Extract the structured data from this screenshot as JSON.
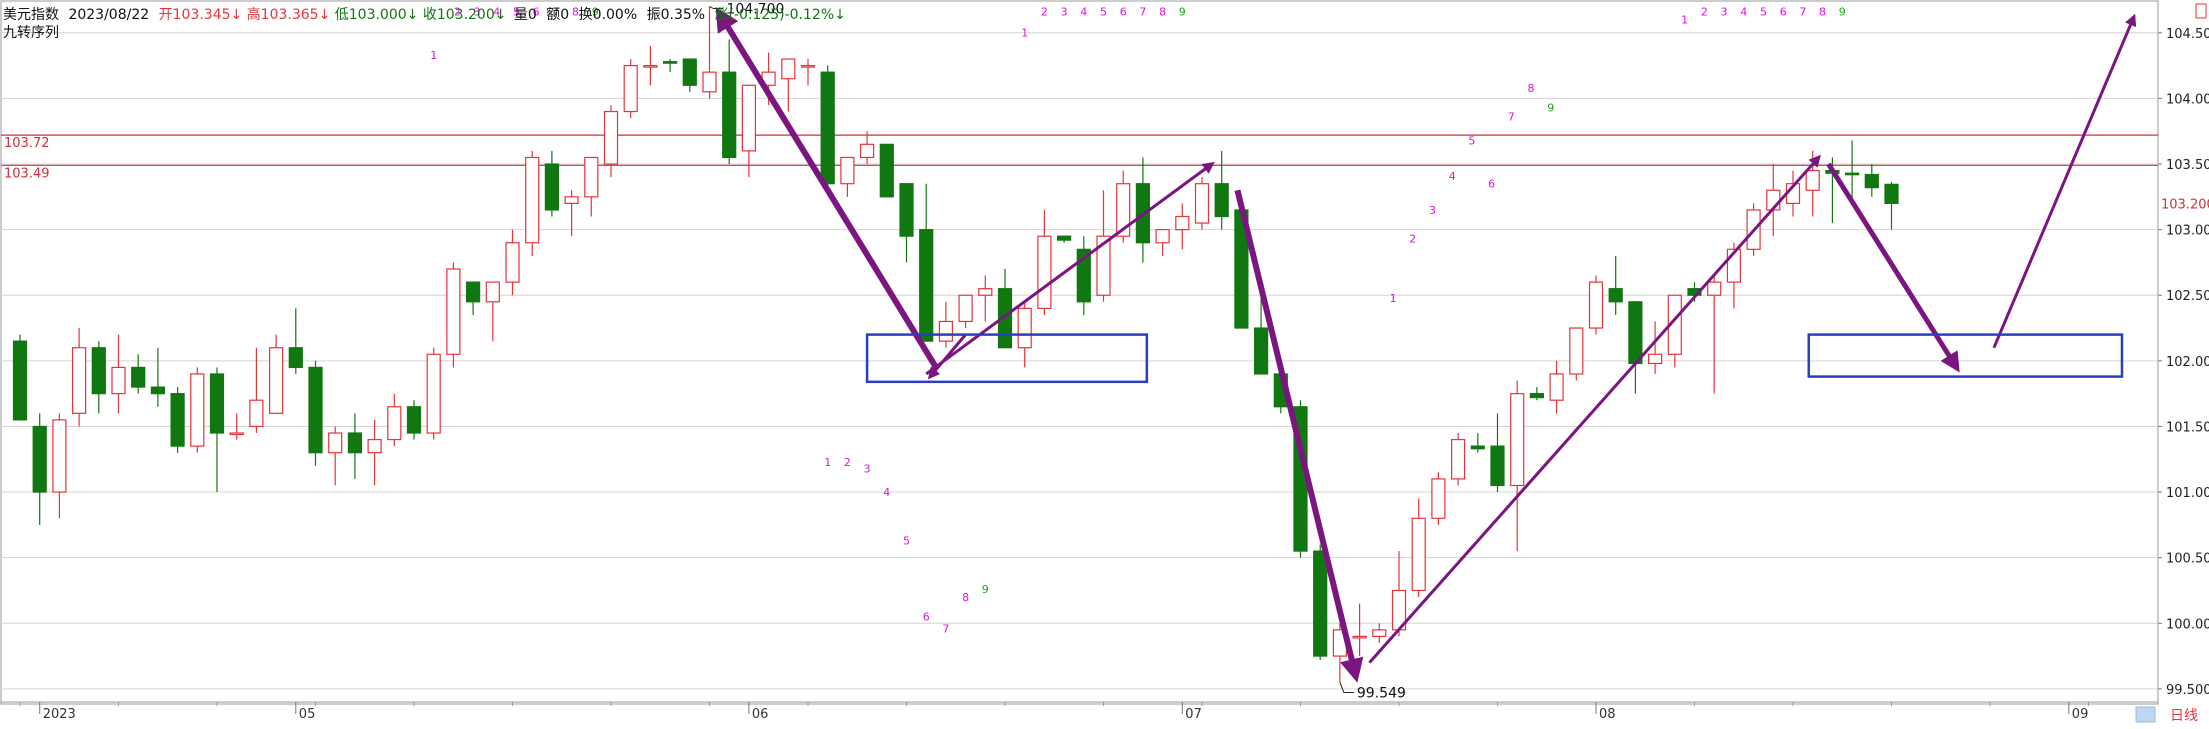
{
  "header": {
    "name": "美元指数",
    "date": "2023/08/22",
    "open": "开103.345↓",
    "high": "高103.365↓",
    "low": "低103.000↓",
    "close": "收103.200↓",
    "volume": "量0",
    "amount": "额0",
    "turnover": "换0.00%",
    "amplitude": "振0.35%",
    "change": "涨(-0.125)-0.12%↓"
  },
  "indicator_label": "九转序列",
  "footer_label": "日线",
  "colors": {
    "up": "#e8333a",
    "down": "#117711",
    "grid": "#d4d4d4",
    "arrow": "#7b1580",
    "box": "#2a3fbf",
    "seq_magenta": "#e010e0",
    "seq_green": "#1aa51a"
  },
  "chart_data": {
    "type": "candlestick",
    "ylim": [
      99.4,
      104.75
    ],
    "yticks": [
      "104.500",
      "104.000",
      "103.500",
      "103.000",
      "102.500",
      "102.000",
      "101.500",
      "101.000",
      "100.500",
      "100.000",
      "99.500"
    ],
    "ytick_values": [
      104.5,
      104.0,
      103.5,
      103.0,
      102.5,
      102.0,
      101.5,
      101.0,
      100.5,
      100.0,
      99.5
    ],
    "xlabels": [
      {
        "label": "2023",
        "index": 1
      },
      {
        "label": "05",
        "index": 14
      },
      {
        "label": "06",
        "index": 37
      },
      {
        "label": "07",
        "index": 59
      },
      {
        "label": "08",
        "index": 80
      },
      {
        "label": "09",
        "index": 104
      }
    ],
    "candles": [
      {
        "o": 102.15,
        "h": 102.2,
        "l": 101.55,
        "c": 101.55
      },
      {
        "o": 101.5,
        "h": 101.6,
        "l": 100.75,
        "c": 101.0
      },
      {
        "o": 101.0,
        "h": 101.6,
        "l": 100.8,
        "c": 101.55
      },
      {
        "o": 101.6,
        "h": 102.25,
        "l": 101.5,
        "c": 102.1
      },
      {
        "o": 102.1,
        "h": 102.15,
        "l": 101.6,
        "c": 101.75
      },
      {
        "o": 101.75,
        "h": 102.2,
        "l": 101.6,
        "c": 101.95
      },
      {
        "o": 101.95,
        "h": 102.05,
        "l": 101.75,
        "c": 101.8
      },
      {
        "o": 101.8,
        "h": 102.1,
        "l": 101.65,
        "c": 101.75
      },
      {
        "o": 101.75,
        "h": 101.8,
        "l": 101.3,
        "c": 101.35
      },
      {
        "o": 101.35,
        "h": 101.95,
        "l": 101.3,
        "c": 101.9
      },
      {
        "o": 101.9,
        "h": 101.95,
        "l": 101.0,
        "c": 101.45
      },
      {
        "o": 101.45,
        "h": 101.6,
        "l": 101.4,
        "c": 101.45
      },
      {
        "o": 101.5,
        "h": 102.1,
        "l": 101.45,
        "c": 101.7
      },
      {
        "o": 101.6,
        "h": 102.2,
        "l": 101.6,
        "c": 102.1
      },
      {
        "o": 102.1,
        "h": 102.4,
        "l": 101.9,
        "c": 101.95
      },
      {
        "o": 101.95,
        "h": 102.0,
        "l": 101.2,
        "c": 101.3
      },
      {
        "o": 101.3,
        "h": 101.5,
        "l": 101.05,
        "c": 101.45
      },
      {
        "o": 101.45,
        "h": 101.6,
        "l": 101.1,
        "c": 101.3
      },
      {
        "o": 101.3,
        "h": 101.55,
        "l": 101.05,
        "c": 101.4
      },
      {
        "o": 101.4,
        "h": 101.75,
        "l": 101.35,
        "c": 101.65
      },
      {
        "o": 101.65,
        "h": 101.7,
        "l": 101.4,
        "c": 101.45
      },
      {
        "o": 101.45,
        "h": 102.1,
        "l": 101.4,
        "c": 102.05
      },
      {
        "o": 102.05,
        "h": 102.75,
        "l": 101.95,
        "c": 102.7
      },
      {
        "o": 102.6,
        "h": 102.6,
        "l": 102.35,
        "c": 102.45
      },
      {
        "o": 102.45,
        "h": 102.6,
        "l": 102.15,
        "c": 102.6
      },
      {
        "o": 102.6,
        "h": 103.0,
        "l": 102.5,
        "c": 102.9
      },
      {
        "o": 102.9,
        "h": 103.6,
        "l": 102.8,
        "c": 103.55
      },
      {
        "o": 103.5,
        "h": 103.6,
        "l": 103.1,
        "c": 103.15
      },
      {
        "o": 103.2,
        "h": 103.3,
        "l": 102.95,
        "c": 103.25
      },
      {
        "o": 103.25,
        "h": 103.55,
        "l": 103.1,
        "c": 103.55
      },
      {
        "o": 103.5,
        "h": 103.95,
        "l": 103.4,
        "c": 103.9
      },
      {
        "o": 103.9,
        "h": 104.3,
        "l": 103.85,
        "c": 104.25
      },
      {
        "o": 104.25,
        "h": 104.4,
        "l": 104.1,
        "c": 104.25
      },
      {
        "o": 104.28,
        "h": 104.3,
        "l": 104.2,
        "c": 104.27
      },
      {
        "o": 104.3,
        "h": 104.3,
        "l": 104.05,
        "c": 104.1
      },
      {
        "o": 104.05,
        "h": 104.7,
        "l": 104.0,
        "c": 104.2
      },
      {
        "o": 104.2,
        "h": 104.45,
        "l": 103.5,
        "c": 103.55
      },
      {
        "o": 103.6,
        "h": 104.1,
        "l": 103.4,
        "c": 104.1
      },
      {
        "o": 104.1,
        "h": 104.35,
        "l": 103.95,
        "c": 104.2
      },
      {
        "o": 104.15,
        "h": 104.3,
        "l": 103.9,
        "c": 104.3
      },
      {
        "o": 104.25,
        "h": 104.3,
        "l": 104.1,
        "c": 104.25
      },
      {
        "o": 104.2,
        "h": 104.25,
        "l": 103.3,
        "c": 103.35
      },
      {
        "o": 103.35,
        "h": 103.55,
        "l": 103.25,
        "c": 103.55
      },
      {
        "o": 103.55,
        "h": 103.75,
        "l": 103.5,
        "c": 103.65
      },
      {
        "o": 103.65,
        "h": 103.65,
        "l": 103.25,
        "c": 103.25
      },
      {
        "o": 103.35,
        "h": 103.35,
        "l": 102.75,
        "c": 102.95
      },
      {
        "o": 103.0,
        "h": 103.35,
        "l": 102.15,
        "c": 102.15
      },
      {
        "o": 102.15,
        "h": 102.45,
        "l": 102.1,
        "c": 102.3
      },
      {
        "o": 102.3,
        "h": 102.5,
        "l": 102.25,
        "c": 102.5
      },
      {
        "o": 102.5,
        "h": 102.65,
        "l": 102.3,
        "c": 102.55
      },
      {
        "o": 102.55,
        "h": 102.7,
        "l": 102.1,
        "c": 102.1
      },
      {
        "o": 102.1,
        "h": 102.45,
        "l": 101.95,
        "c": 102.4
      },
      {
        "o": 102.4,
        "h": 103.15,
        "l": 102.35,
        "c": 102.95
      },
      {
        "o": 102.95,
        "h": 102.95,
        "l": 102.9,
        "c": 102.92
      },
      {
        "o": 102.85,
        "h": 102.95,
        "l": 102.35,
        "c": 102.45
      },
      {
        "o": 102.5,
        "h": 103.3,
        "l": 102.45,
        "c": 102.95
      },
      {
        "o": 102.95,
        "h": 103.45,
        "l": 102.9,
        "c": 103.35
      },
      {
        "o": 103.35,
        "h": 103.55,
        "l": 102.75,
        "c": 102.9
      },
      {
        "o": 102.9,
        "h": 103.0,
        "l": 102.8,
        "c": 103.0
      },
      {
        "o": 103.0,
        "h": 103.2,
        "l": 102.85,
        "c": 103.1
      },
      {
        "o": 103.05,
        "h": 103.4,
        "l": 103.0,
        "c": 103.35
      },
      {
        "o": 103.35,
        "h": 103.6,
        "l": 103.0,
        "c": 103.1
      },
      {
        "o": 103.15,
        "h": 103.2,
        "l": 102.25,
        "c": 102.25
      },
      {
        "o": 102.25,
        "h": 102.55,
        "l": 101.9,
        "c": 101.9
      },
      {
        "o": 101.9,
        "h": 102.0,
        "l": 101.6,
        "c": 101.65
      },
      {
        "o": 101.65,
        "h": 101.7,
        "l": 100.5,
        "c": 100.55
      },
      {
        "o": 100.55,
        "h": 100.6,
        "l": 99.72,
        "c": 99.75
      },
      {
        "o": 99.75,
        "h": 100.0,
        "l": 99.55,
        "c": 99.95
      },
      {
        "o": 99.9,
        "h": 100.15,
        "l": 99.75,
        "c": 99.9
      },
      {
        "o": 99.9,
        "h": 100.0,
        "l": 99.85,
        "c": 99.95
      },
      {
        "o": 99.95,
        "h": 100.55,
        "l": 99.9,
        "c": 100.25
      },
      {
        "o": 100.25,
        "h": 100.95,
        "l": 100.2,
        "c": 100.8
      },
      {
        "o": 100.8,
        "h": 101.15,
        "l": 100.75,
        "c": 101.1
      },
      {
        "o": 101.1,
        "h": 101.45,
        "l": 101.05,
        "c": 101.4
      },
      {
        "o": 101.35,
        "h": 101.45,
        "l": 101.3,
        "c": 101.33
      },
      {
        "o": 101.35,
        "h": 101.6,
        "l": 101.0,
        "c": 101.05
      },
      {
        "o": 101.05,
        "h": 101.85,
        "l": 100.55,
        "c": 101.75
      },
      {
        "o": 101.75,
        "h": 101.8,
        "l": 101.7,
        "c": 101.72
      },
      {
        "o": 101.7,
        "h": 102.0,
        "l": 101.6,
        "c": 101.9
      },
      {
        "o": 101.9,
        "h": 102.25,
        "l": 101.85,
        "c": 102.25
      },
      {
        "o": 102.25,
        "h": 102.65,
        "l": 102.2,
        "c": 102.6
      },
      {
        "o": 102.55,
        "h": 102.8,
        "l": 102.35,
        "c": 102.45
      },
      {
        "o": 102.45,
        "h": 102.45,
        "l": 101.75,
        "c": 101.98
      },
      {
        "o": 101.98,
        "h": 102.3,
        "l": 101.9,
        "c": 102.05
      },
      {
        "o": 102.05,
        "h": 102.5,
        "l": 101.95,
        "c": 102.5
      },
      {
        "o": 102.55,
        "h": 102.6,
        "l": 102.45,
        "c": 102.5
      },
      {
        "o": 102.5,
        "h": 102.65,
        "l": 101.75,
        "c": 102.6
      },
      {
        "o": 102.6,
        "h": 102.9,
        "l": 102.4,
        "c": 102.85
      },
      {
        "o": 102.85,
        "h": 103.2,
        "l": 102.8,
        "c": 103.15
      },
      {
        "o": 103.15,
        "h": 103.5,
        "l": 102.95,
        "c": 103.3
      },
      {
        "o": 103.2,
        "h": 103.45,
        "l": 103.1,
        "c": 103.35
      },
      {
        "o": 103.3,
        "h": 103.6,
        "l": 103.1,
        "c": 103.45
      },
      {
        "o": 103.45,
        "h": 103.55,
        "l": 103.05,
        "c": 103.43
      },
      {
        "o": 103.43,
        "h": 103.68,
        "l": 103.2,
        "c": 103.42
      },
      {
        "o": 103.42,
        "h": 103.5,
        "l": 103.25,
        "c": 103.32
      },
      {
        "o": 103.345,
        "h": 103.365,
        "l": 103.0,
        "c": 103.2
      }
    ],
    "reference_lines": [
      {
        "value": 103.72,
        "label": "103.72"
      },
      {
        "value": 103.49,
        "label": "103.49"
      }
    ],
    "last_price": {
      "value": 103.2,
      "label": "103.200"
    },
    "annotations": [
      {
        "text": "104.700",
        "index": 35,
        "value": 104.7
      },
      {
        "text": "99.549",
        "index": 67,
        "value": 99.549
      }
    ],
    "sequence_marks": [
      {
        "t": "1",
        "x": 21,
        "y": 104.3,
        "c": "m"
      },
      {
        "t": "2",
        "x": 22.2,
        "y": 104.63,
        "c": "m"
      },
      {
        "t": "3",
        "x": 23.2,
        "y": 104.63,
        "c": "m"
      },
      {
        "t": "4",
        "x": 24.2,
        "y": 104.63,
        "c": "m"
      },
      {
        "t": "5",
        "x": 25.2,
        "y": 104.63,
        "c": "m"
      },
      {
        "t": "6",
        "x": 26.2,
        "y": 104.63,
        "c": "m"
      },
      {
        "t": "7",
        "x": 27.2,
        "y": 104.63,
        "c": "m"
      },
      {
        "t": "8",
        "x": 28.2,
        "y": 104.63,
        "c": "m"
      },
      {
        "t": "9",
        "x": 29.2,
        "y": 104.63,
        "c": "g"
      },
      {
        "t": "1",
        "x": 41,
        "y": 101.2,
        "c": "m"
      },
      {
        "t": "2",
        "x": 42,
        "y": 101.2,
        "c": "m"
      },
      {
        "t": "3",
        "x": 43,
        "y": 101.15,
        "c": "m"
      },
      {
        "t": "4",
        "x": 44,
        "y": 100.97,
        "c": "m"
      },
      {
        "t": "5",
        "x": 45,
        "y": 100.6,
        "c": "m"
      },
      {
        "t": "6",
        "x": 46,
        "y": 100.02,
        "c": "m"
      },
      {
        "t": "7",
        "x": 47,
        "y": 99.93,
        "c": "m"
      },
      {
        "t": "8",
        "x": 48,
        "y": 100.17,
        "c": "m"
      },
      {
        "t": "9",
        "x": 49,
        "y": 100.23,
        "c": "g"
      },
      {
        "t": "1",
        "x": 51,
        "y": 104.47,
        "c": "m"
      },
      {
        "t": "2",
        "x": 52,
        "y": 104.63,
        "c": "m"
      },
      {
        "t": "3",
        "x": 53,
        "y": 104.63,
        "c": "m"
      },
      {
        "t": "4",
        "x": 54,
        "y": 104.63,
        "c": "m"
      },
      {
        "t": "5",
        "x": 55,
        "y": 104.63,
        "c": "m"
      },
      {
        "t": "6",
        "x": 56,
        "y": 104.63,
        "c": "m"
      },
      {
        "t": "7",
        "x": 57,
        "y": 104.63,
        "c": "m"
      },
      {
        "t": "8",
        "x": 58,
        "y": 104.63,
        "c": "m"
      },
      {
        "t": "9",
        "x": 59,
        "y": 104.63,
        "c": "g"
      },
      {
        "t": "1",
        "x": 69.7,
        "y": 102.45,
        "c": "m"
      },
      {
        "t": "2",
        "x": 70.7,
        "y": 102.9,
        "c": "m"
      },
      {
        "t": "3",
        "x": 71.7,
        "y": 103.12,
        "c": "m"
      },
      {
        "t": "4",
        "x": 72.7,
        "y": 103.38,
        "c": "m"
      },
      {
        "t": "5",
        "x": 73.7,
        "y": 103.65,
        "c": "m"
      },
      {
        "t": "6",
        "x": 74.7,
        "y": 103.32,
        "c": "m"
      },
      {
        "t": "7",
        "x": 75.7,
        "y": 103.83,
        "c": "m"
      },
      {
        "t": "8",
        "x": 76.7,
        "y": 104.05,
        "c": "m"
      },
      {
        "t": "9",
        "x": 77.7,
        "y": 103.9,
        "c": "g"
      },
      {
        "t": "1",
        "x": 84.5,
        "y": 104.57,
        "c": "m"
      },
      {
        "t": "2",
        "x": 85.5,
        "y": 104.63,
        "c": "m"
      },
      {
        "t": "3",
        "x": 86.5,
        "y": 104.63,
        "c": "m"
      },
      {
        "t": "4",
        "x": 87.5,
        "y": 104.63,
        "c": "m"
      },
      {
        "t": "5",
        "x": 88.5,
        "y": 104.63,
        "c": "m"
      },
      {
        "t": "6",
        "x": 89.5,
        "y": 104.63,
        "c": "m"
      },
      {
        "t": "7",
        "x": 90.5,
        "y": 104.63,
        "c": "m"
      },
      {
        "t": "8",
        "x": 91.5,
        "y": 104.63,
        "c": "m"
      },
      {
        "t": "9",
        "x": 92.5,
        "y": 104.63,
        "c": "g"
      }
    ],
    "arrows": [
      {
        "x1": 46.5,
        "y1": 101.95,
        "x2": 35.5,
        "y2": 104.65,
        "w": 6
      },
      {
        "x1": 48.0,
        "y1": 102.2,
        "x2": 46.2,
        "y2": 101.88,
        "w": 3
      },
      {
        "x1": 46.0,
        "y1": 101.9,
        "x2": 60.5,
        "y2": 103.5,
        "w": 3
      },
      {
        "x1": 61.8,
        "y1": 103.3,
        "x2": 67.8,
        "y2": 99.6,
        "w": 6
      },
      {
        "x1": 68.5,
        "y1": 99.7,
        "x2": 91.3,
        "y2": 103.55,
        "w": 3
      },
      {
        "x1": 91.8,
        "y1": 103.5,
        "x2": 98.3,
        "y2": 101.95,
        "w": 5
      },
      {
        "x1": 100.2,
        "y1": 102.1,
        "x2": 107.3,
        "y2": 104.62,
        "w": 3
      }
    ],
    "boxes": [
      {
        "x1": 43.0,
        "x2": 57.2,
        "y1": 102.2,
        "y2": 101.84
      },
      {
        "x1": 90.8,
        "x2": 106.7,
        "y1": 102.2,
        "y2": 101.88
      }
    ]
  }
}
